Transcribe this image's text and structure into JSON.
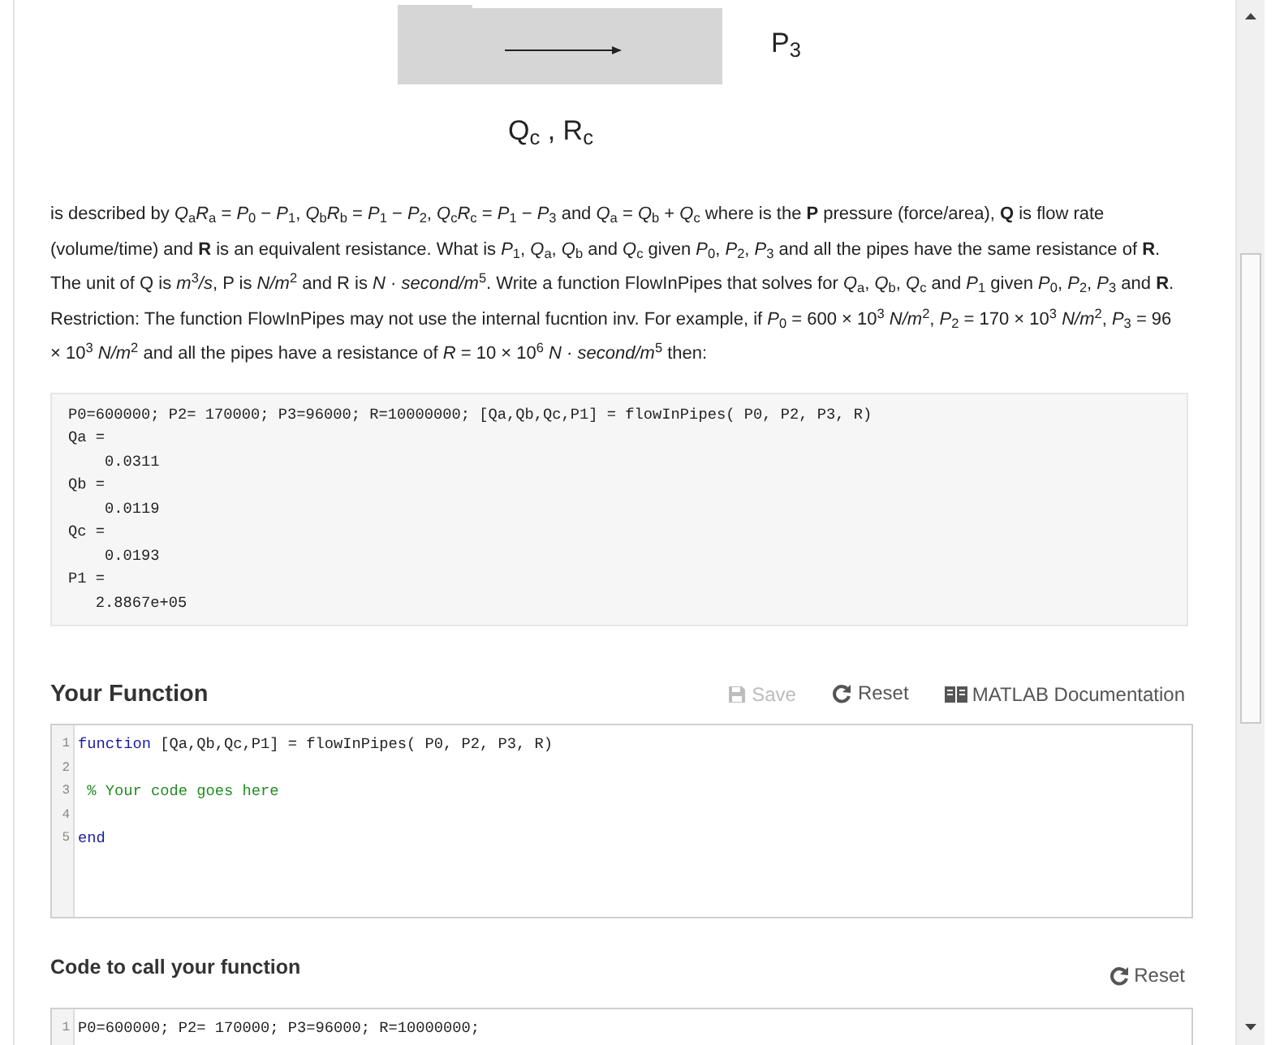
{
  "diagram": {
    "pressure_label": "P$_{3}$",
    "pipe_label": "Q$_{c}$ , R$_{c}$"
  },
  "description": "is described by *Q*$_{a}$*R*$_{a}$ = *P*$_{0}$ − *P*$_{1}$, *Q*$_{b}$*R*$_{b}$ = *P*$_{1}$ − *P*$_{2}$, *Q*$_{c}$*R*$_{c}$ = *P*$_{1}$ − *P*$_{3}$ and  *Q*$_{a}$ = *Q*$_{b}$ + *Q*$_{c}$ where is the **P** pressure (force/area), **Q** is flow rate (volume/time) and **R** is an equivalent resistance.   What is *P*$_{1}$,  *Q*$_{a}$, *Q*$_{b}$ and *Q*$_{c}$ given *P*$_{0}$, *P*$_{2}$, *P*$_{3}$ and all the pipes have the same resistance of **R**. The unit of Q is *m*$^{3}$*/s*, P is *N/m*$^{2}$ and R is *N · second/m*$^{5}$.  Write a function FlowInPipes that solves for *Q*$_{a}$, *Q*$_{b}$, *Q*$_{c}$ and *P*$_{1}$ given *P*$_{0}$, *P*$_{2}$, *P*$_{3}$ and **R**.  Restriction:  The function FlowInPipes may not use the internal fucntion inv. For example, if *P*$_{0}$ = 600 × 10$^{3}$ *N/m*$^{2}$, *P*$_{2}$ = 170 × 10$^{3}$ *N/m*$^{2}$, *P*$_{3}$ = 96 × 10$^{3}$ *N/m*$^{2}$ and all the pipes have a resistance of *R* = 10 × 10$^{6}$ *N · second/m*$^{5}$ then:",
  "example_output": [
    "P0=600000; P2= 170000; P3=96000; R=10000000; [Qa,Qb,Qc,P1] = flowInPipes( P0, P2, P3, R)",
    "Qa =",
    "    0.0311",
    "Qb =",
    "    0.0119",
    "Qc =",
    "    0.0193",
    "P1 =",
    "   2.8867e+05"
  ],
  "function_section": {
    "title": "Your Function",
    "buttons": [
      {
        "label": "Save",
        "kind": "save",
        "disabled": true
      },
      {
        "label": "Reset",
        "kind": "reset",
        "disabled": false
      },
      {
        "label": "MATLAB Documentation",
        "kind": "documentation",
        "disabled": false
      }
    ],
    "editor": [
      {
        "number": "1",
        "tokens": [
          {
            "kind": "keyword",
            "text": "function"
          },
          {
            "kind": "plain",
            "text": " [Qa,Qb,Qc,P1] = flowInPipes( P0, P2, P3, R)"
          }
        ]
      },
      {
        "number": "2"
      },
      {
        "number": "3",
        "tokens": [
          {
            "kind": "comment",
            "text": " % Your code goes here"
          }
        ]
      },
      {
        "number": "4"
      },
      {
        "number": "5",
        "tokens": [
          {
            "kind": "keyword",
            "text": "end"
          }
        ]
      }
    ]
  },
  "call_section": {
    "title": "Code to call your function",
    "buttons": [
      {
        "label": "Reset",
        "kind": "reset",
        "disabled": false
      }
    ],
    "editor": [
      {
        "number": "1",
        "tokens": [
          {
            "kind": "plain",
            "text": "P0=600000; P2= 170000; P3=96000; R=10000000;"
          }
        ]
      }
    ]
  }
}
